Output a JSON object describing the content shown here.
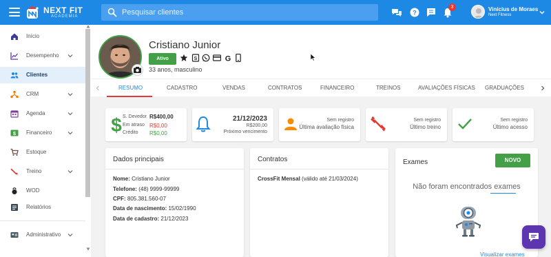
{
  "topbar": {
    "logo_text": "NEXT FIT",
    "logo_sub": "ACADEMIA",
    "search_placeholder": "Pesquisar clientes",
    "notifications_count": "3",
    "user_name": "Vinícius de Moraes",
    "user_company": "Next Fitness",
    "icons": [
      "menu-icon",
      "chat-bubbles-icon",
      "help-icon",
      "message-icon",
      "bell-icon",
      "chevron-down-icon"
    ]
  },
  "sidebar": {
    "items": [
      {
        "label": "Início",
        "icon": "home-icon"
      },
      {
        "label": "Desempenho",
        "icon": "chart-icon",
        "expandable": true
      },
      {
        "label": "Clientes",
        "icon": "people-icon",
        "active": true
      },
      {
        "label": "CRM",
        "icon": "network-icon",
        "expandable": true
      },
      {
        "label": "Agenda",
        "icon": "calendar-icon",
        "expandable": true
      },
      {
        "label": "Financeiro",
        "icon": "money-icon",
        "expandable": true
      },
      {
        "label": "Estoque",
        "icon": "cart-icon"
      },
      {
        "label": "Treino",
        "icon": "dumbbell-icon",
        "expandable": true
      },
      {
        "label": "WOD",
        "icon": "kettlebell-icon"
      },
      {
        "label": "Relatórios",
        "icon": "report-icon"
      },
      {
        "label": "Administrativo",
        "icon": "admin-icon",
        "expandable": true
      }
    ]
  },
  "profile": {
    "name": "Cristiano Junior",
    "status": "Ativo",
    "subtitle": "33 anos, masculino",
    "action_icons": [
      "star-icon",
      "document-icon",
      "whatsapp-icon",
      "card-icon",
      "google-icon",
      "phone-icon"
    ]
  },
  "tabs": [
    "RESUMO",
    "CADASTRO",
    "VENDAS",
    "CONTRATOS",
    "FINANCEIRO",
    "TREINOS",
    "AVALIAÇÕES FÍSICAS",
    "GRADUAÇÕES"
  ],
  "stats": {
    "finance": {
      "rows": [
        {
          "label": "S. Devedor",
          "value": "R$400,00",
          "color": "#333333"
        },
        {
          "label": "Em atraso",
          "value": "R$0,00",
          "color": "#e53935"
        },
        {
          "label": "Crédito",
          "value": "R$0,00",
          "color": "#43a047"
        }
      ]
    },
    "due": {
      "date": "21/12/2023",
      "amount": "R$200,00",
      "label": "Próximo vencimento"
    },
    "evaluation": {
      "status": "Sem registro",
      "label": "Última avaliação física"
    },
    "workout": {
      "status": "Sem registro",
      "label": "Último treino"
    },
    "access": {
      "status": "Sem registro",
      "label": "Último acesso"
    }
  },
  "dados": {
    "title": "Dados principais",
    "rows": [
      {
        "label": "Nome:",
        "value": "Cristiano Junior"
      },
      {
        "label": "Telefone:",
        "value": "(48) 9999-99999"
      },
      {
        "label": "CPF:",
        "value": "805.381.560-07"
      },
      {
        "label": "Data de nascimento:",
        "value": "15/02/1990"
      },
      {
        "label": "Data de cadastro:",
        "value": "21/12/2023"
      }
    ]
  },
  "contratos": {
    "title": "Contratos",
    "item_name": "CrossFit Mensal",
    "item_detail": "(válido até 21/03/2024)"
  },
  "exames": {
    "title": "Exames",
    "button": "NOVO",
    "empty": "Não foram encontrados exames",
    "link": "Visualizar exames"
  },
  "colors": {
    "primary": "#1e88e5",
    "success": "#43a047",
    "danger": "#e53935",
    "chat": "#5e35b1"
  }
}
